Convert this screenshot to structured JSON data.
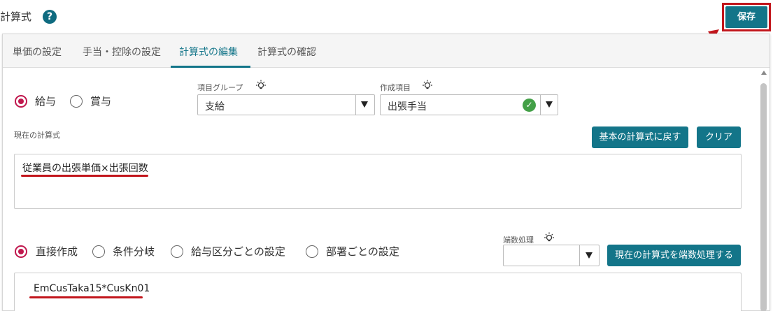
{
  "header": {
    "title": "計算式",
    "save_label": "保存"
  },
  "tabs": [
    {
      "label": "単価の設定"
    },
    {
      "label": "手当・控除の設定"
    },
    {
      "label": "計算式の編集"
    },
    {
      "label": "計算式の確認"
    }
  ],
  "pay_type": {
    "options": [
      "給与",
      "賞与"
    ],
    "selected": "給与"
  },
  "item_group": {
    "label": "項目グループ",
    "value": "支給"
  },
  "created_item": {
    "label": "作成項目",
    "value": "出張手当"
  },
  "current_formula": {
    "label": "現在の計算式",
    "value": "従業員の出張単価×出張回数",
    "reset_label": "基本の計算式に戻す",
    "clear_label": "クリア"
  },
  "create_mode": {
    "options": [
      "直接作成",
      "条件分岐",
      "給与区分ごとの設定",
      "部署ごとの設定"
    ],
    "selected": "直接作成"
  },
  "rounding": {
    "label": "端数処理",
    "value": "",
    "apply_label": "現在の計算式を端数処理する"
  },
  "direct_formula": {
    "value": "EmCusTaka15*CusKn01"
  },
  "colors": {
    "accent": "#137589",
    "highlight": "#c2161c",
    "radio": "#c0174d"
  }
}
